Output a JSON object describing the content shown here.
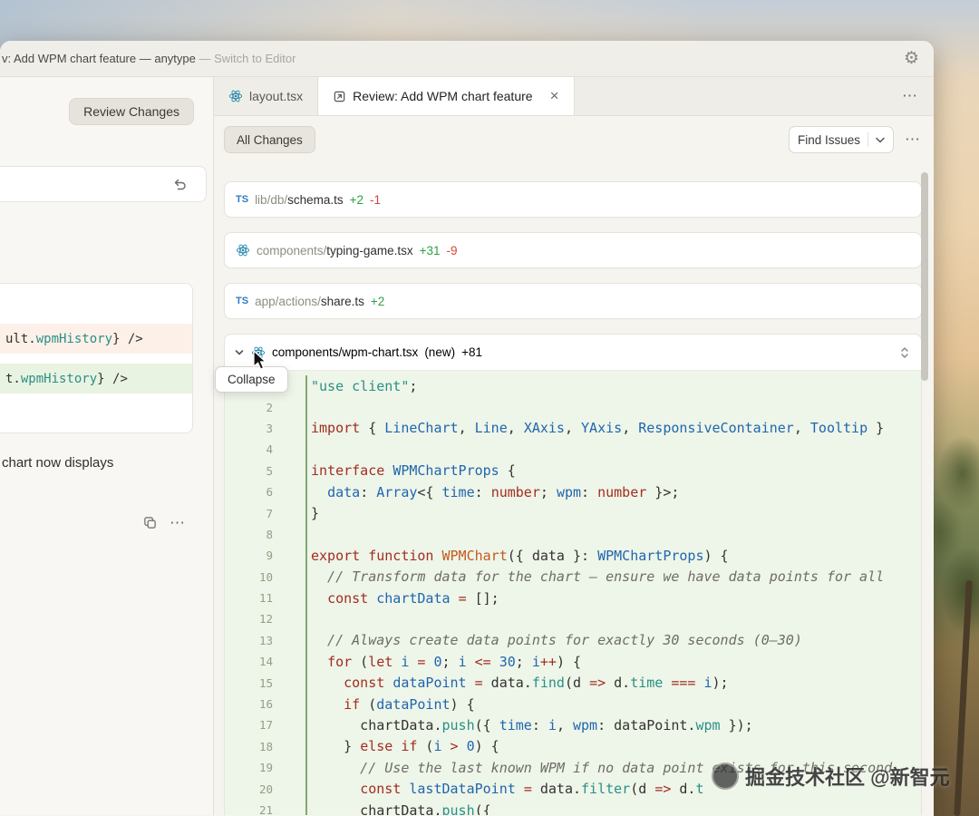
{
  "titlebar": {
    "title": "v: Add WPM chart feature — anytype ",
    "title_secondary": "—  Switch to Editor"
  },
  "icons": {
    "ts": "TS",
    "more": "⋯",
    "gear": "⚙"
  },
  "left_panel": {
    "review_changes": "Review Changes",
    "note": "chart now displays",
    "diff_lines": [
      {
        "kind": "removed",
        "tokens": [
          [
            "pun",
            "ult."
          ],
          [
            "mth",
            "wpmHistory"
          ],
          [
            "pun",
            "} />"
          ]
        ]
      },
      {
        "kind": "added",
        "tokens": [
          [
            "pun",
            "t."
          ],
          [
            "mth",
            "wpmHistory"
          ],
          [
            "pun",
            "} />"
          ]
        ]
      }
    ]
  },
  "tabs": [
    {
      "label": "layout.tsx"
    },
    {
      "label": "Review: Add WPM chart feature",
      "close": "×"
    }
  ],
  "toolbar": {
    "all_changes": "All Changes",
    "find_issues": "Find Issues"
  },
  "files": [
    {
      "icon": "ts",
      "dir": "lib/db/",
      "name": "schema.ts",
      "added": "+2",
      "removed": "-1",
      "badge": ""
    },
    {
      "icon": "react",
      "dir": "components/",
      "name": "typing-game.tsx",
      "added": "+31",
      "removed": "-9",
      "badge": ""
    },
    {
      "icon": "ts",
      "dir": "app/actions/",
      "name": "share.ts",
      "added": "+2",
      "removed": "",
      "badge": ""
    },
    {
      "icon": "react",
      "dir": "components/",
      "name": "wpm-chart.tsx",
      "added": "+81",
      "removed": "",
      "badge": "(new)"
    }
  ],
  "tooltip": "Collapse",
  "watermark": "掘金技术社区 @新智元",
  "code_lines": [
    [
      [
        "str",
        "\"use client\""
      ],
      [
        "pun",
        ";"
      ]
    ],
    [],
    [
      [
        "kw",
        "import"
      ],
      [
        "pun",
        " { "
      ],
      [
        "typ",
        "LineChart"
      ],
      [
        "pun",
        ", "
      ],
      [
        "typ",
        "Line"
      ],
      [
        "pun",
        ", "
      ],
      [
        "typ",
        "XAxis"
      ],
      [
        "pun",
        ", "
      ],
      [
        "typ",
        "YAxis"
      ],
      [
        "pun",
        ", "
      ],
      [
        "typ",
        "ResponsiveContainer"
      ],
      [
        "pun",
        ", "
      ],
      [
        "typ",
        "Tooltip"
      ],
      [
        "pun",
        " }"
      ]
    ],
    [],
    [
      [
        "kw",
        "interface"
      ],
      [
        "pun",
        " "
      ],
      [
        "typ",
        "WPMChartProps"
      ],
      [
        "pun",
        " {"
      ]
    ],
    [
      [
        "pun",
        "  "
      ],
      [
        "vb",
        "data"
      ],
      [
        "pun",
        ": "
      ],
      [
        "typ",
        "Array"
      ],
      [
        "pun",
        "<{ "
      ],
      [
        "vb",
        "time"
      ],
      [
        "pun",
        ": "
      ],
      [
        "kw",
        "number"
      ],
      [
        "pun",
        "; "
      ],
      [
        "vb",
        "wpm"
      ],
      [
        "pun",
        ": "
      ],
      [
        "kw",
        "number"
      ],
      [
        "pun",
        " }>;"
      ]
    ],
    [
      [
        "pun",
        "}"
      ]
    ],
    [],
    [
      [
        "kw",
        "export"
      ],
      [
        "pun",
        " "
      ],
      [
        "kw",
        "function"
      ],
      [
        "pun",
        " "
      ],
      [
        "fn",
        "WPMChart"
      ],
      [
        "pun",
        "({ data }: "
      ],
      [
        "typ",
        "WPMChartProps"
      ],
      [
        "pun",
        ") {"
      ]
    ],
    [
      [
        "com",
        "  // Transform data for the chart — ensure we have data points for all"
      ]
    ],
    [
      [
        "pun",
        "  "
      ],
      [
        "kw",
        "const"
      ],
      [
        "pun",
        " "
      ],
      [
        "vb",
        "chartData"
      ],
      [
        "pun",
        " "
      ],
      [
        "op",
        "="
      ],
      [
        "pun",
        " [];"
      ]
    ],
    [],
    [
      [
        "com",
        "  // Always create data points for exactly 30 seconds (0–30)"
      ]
    ],
    [
      [
        "pun",
        "  "
      ],
      [
        "kw",
        "for"
      ],
      [
        "pun",
        " ("
      ],
      [
        "kw",
        "let"
      ],
      [
        "pun",
        " "
      ],
      [
        "vb",
        "i"
      ],
      [
        "pun",
        " "
      ],
      [
        "op",
        "="
      ],
      [
        "pun",
        " "
      ],
      [
        "num",
        "0"
      ],
      [
        "pun",
        "; "
      ],
      [
        "vb",
        "i"
      ],
      [
        "pun",
        " "
      ],
      [
        "op",
        "<="
      ],
      [
        "pun",
        " "
      ],
      [
        "num",
        "30"
      ],
      [
        "pun",
        "; "
      ],
      [
        "vb",
        "i"
      ],
      [
        "op",
        "++"
      ],
      [
        "pun",
        ") {"
      ]
    ],
    [
      [
        "pun",
        "    "
      ],
      [
        "kw",
        "const"
      ],
      [
        "pun",
        " "
      ],
      [
        "vb",
        "dataPoint"
      ],
      [
        "pun",
        " "
      ],
      [
        "op",
        "="
      ],
      [
        "pun",
        " data."
      ],
      [
        "mth",
        "find"
      ],
      [
        "pun",
        "(d "
      ],
      [
        "op",
        "=>"
      ],
      [
        "pun",
        " d."
      ],
      [
        "mth",
        "time"
      ],
      [
        "pun",
        " "
      ],
      [
        "op",
        "==="
      ],
      [
        "pun",
        " "
      ],
      [
        "vb",
        "i"
      ],
      [
        "pun",
        ");"
      ]
    ],
    [
      [
        "pun",
        "    "
      ],
      [
        "kw",
        "if"
      ],
      [
        "pun",
        " ("
      ],
      [
        "vb",
        "dataPoint"
      ],
      [
        "pun",
        ") {"
      ]
    ],
    [
      [
        "pun",
        "      chartData."
      ],
      [
        "mth",
        "push"
      ],
      [
        "pun",
        "({ "
      ],
      [
        "vb",
        "time"
      ],
      [
        "pun",
        ": "
      ],
      [
        "vb",
        "i"
      ],
      [
        "pun",
        ", "
      ],
      [
        "vb",
        "wpm"
      ],
      [
        "pun",
        ": dataPoint."
      ],
      [
        "mth",
        "wpm"
      ],
      [
        "pun",
        " });"
      ]
    ],
    [
      [
        "pun",
        "    } "
      ],
      [
        "kw",
        "else"
      ],
      [
        "pun",
        " "
      ],
      [
        "kw",
        "if"
      ],
      [
        "pun",
        " ("
      ],
      [
        "vb",
        "i"
      ],
      [
        "pun",
        " "
      ],
      [
        "op",
        ">"
      ],
      [
        "pun",
        " "
      ],
      [
        "num",
        "0"
      ],
      [
        "pun",
        ") {"
      ]
    ],
    [
      [
        "com",
        "      // Use the last known WPM if no data point exists for this second"
      ]
    ],
    [
      [
        "pun",
        "      "
      ],
      [
        "kw",
        "const"
      ],
      [
        "pun",
        " "
      ],
      [
        "vb",
        "lastDataPoint"
      ],
      [
        "pun",
        " "
      ],
      [
        "op",
        "="
      ],
      [
        "pun",
        " data."
      ],
      [
        "mth",
        "filter"
      ],
      [
        "pun",
        "(d "
      ],
      [
        "op",
        "=>"
      ],
      [
        "pun",
        " d."
      ],
      [
        "mth",
        "t"
      ]
    ],
    [
      [
        "pun",
        "      chartData."
      ],
      [
        "mth",
        "push"
      ],
      [
        "pun",
        "({"
      ]
    ]
  ]
}
